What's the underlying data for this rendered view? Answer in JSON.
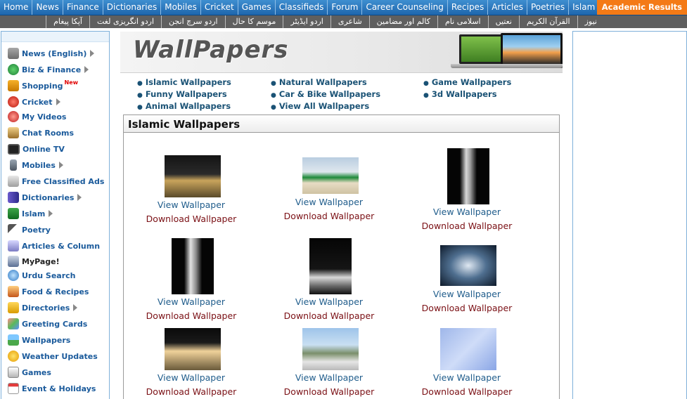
{
  "topnav": {
    "items": [
      "Home",
      "News",
      "Finance",
      "Dictionaries",
      "Mobiles",
      "Cricket",
      "Games",
      "Classifieds",
      "Forum",
      "Career Counseling",
      "Recipes",
      "Articles",
      "Poetries",
      "Islam"
    ],
    "academic": "Academic Results"
  },
  "urdunav": {
    "items": [
      "نیوز",
      "القرآن الکریم",
      "نعتیں",
      "اسلامی نام",
      "کالم اور مضامین",
      "شاعری",
      "اردو ایڈیٹر",
      "موسم کا حال",
      "اردو سرچ انجن",
      "اردو انگریزی لغت",
      "آپکا پیغام"
    ]
  },
  "sidebar": {
    "items": [
      {
        "label": "News (English)",
        "arrow": true
      },
      {
        "label": "Biz & Finance",
        "arrow": true
      },
      {
        "label": "Shopping",
        "badge": "New"
      },
      {
        "label": "Cricket",
        "arrow": true
      },
      {
        "label": "My Videos"
      },
      {
        "label": "Chat Rooms"
      },
      {
        "label": "Online TV"
      },
      {
        "label": "Mobiles",
        "arrow": true
      },
      {
        "label": "Free Classified Ads"
      },
      {
        "label": "Dictionaries",
        "arrow": true
      },
      {
        "label": "Islam",
        "arrow": true
      },
      {
        "label": "Poetry"
      },
      {
        "label": "Articles & Column"
      },
      {
        "label": "MyPage!"
      },
      {
        "label": "Urdu Search"
      },
      {
        "label": "Food & Recipes"
      },
      {
        "label": "Directories",
        "arrow": true
      },
      {
        "label": "Greeting Cards"
      },
      {
        "label": "Wallpapers"
      },
      {
        "label": "Weather Updates"
      },
      {
        "label": "Games"
      },
      {
        "label": "Event & Holidays"
      }
    ]
  },
  "banner": {
    "title": "WallPapers"
  },
  "categories": [
    "Islamic Wallpapers",
    "Natural Wallpapers",
    "Game Wallpapers",
    "Funny Wallpapers",
    "Car & Bike Wallpapers",
    "3d Wallpapers",
    "Animal Wallpapers",
    "View All Wallpapers"
  ],
  "section": {
    "title": "Islamic Wallpapers"
  },
  "wallpapers": {
    "view_label": "View Wallpaper",
    "download_label": "Download Wallpaper"
  },
  "colors": {
    "topnav": "#2a74bb",
    "academic": "#f47a16",
    "urdunav": "#5f5f5f",
    "sidebar_link": "#1a5a9b",
    "view_link": "#1f5c8b",
    "download_link": "#7a0f14"
  }
}
